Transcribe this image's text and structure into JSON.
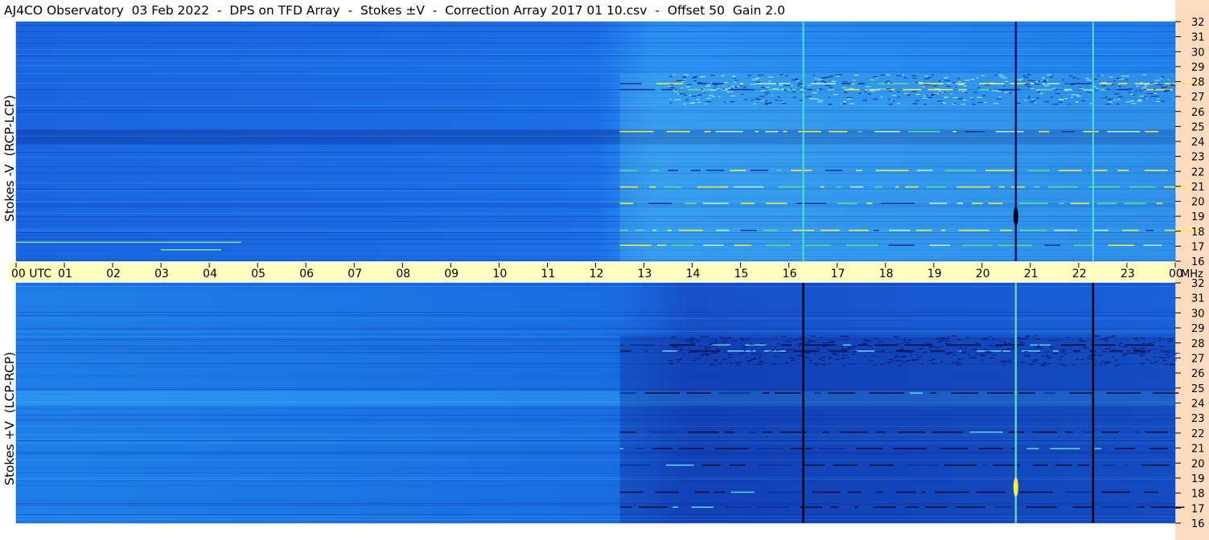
{
  "title": "AJ4CO Observatory  03 Feb 2022  -  DPS on TFD Array  -  Stokes ±V  -  Correction Array 2017 01 10.csv  -  Offset 50  Gain 2.0",
  "colors": {
    "background_blue": "#1a6fe8",
    "dark_blue": "#0a2f9a",
    "cyan": "#40c8f0",
    "green": "#5fe08a",
    "yellow": "#f0f040",
    "black": "#000000",
    "time_axis_bg": "#ffffc0",
    "freq_axis_bg": "#ffdcc0"
  },
  "chart_data": [
    {
      "type": "heatmap",
      "name": "stokes-minus-v",
      "ylabel": "Stokes -V  (RCP-LCP)",
      "y_ticks": [
        "32",
        "31",
        "30",
        "29",
        "28",
        "27",
        "26",
        "25",
        "24",
        "23",
        "22",
        "21",
        "20",
        "19",
        "18",
        "17",
        "16"
      ],
      "ylim": [
        16,
        32
      ],
      "y_unit": "MHz",
      "xlim": [
        0,
        24
      ],
      "x_unit": "UTC hours",
      "features": {
        "activity_start_hour": 12.5,
        "vertical_lines_hours": [
          16.3,
          20.7,
          22.3
        ],
        "strong_bands_mhz": [
          17.1,
          18.1,
          19.9,
          21.0,
          22.1,
          24.7,
          27.5,
          27.9
        ]
      }
    },
    {
      "type": "heatmap",
      "name": "stokes-plus-v",
      "ylabel": "Stokes +V  (LCP-RCP)",
      "y_ticks": [
        "32",
        "31",
        "30",
        "29",
        "28",
        "27",
        "26",
        "25",
        "24",
        "23",
        "22",
        "21",
        "20",
        "19",
        "18",
        "17",
        "16"
      ],
      "ylim": [
        16,
        32
      ],
      "y_unit": "MHz",
      "xlim": [
        0,
        24
      ],
      "x_unit": "UTC hours",
      "features": {
        "activity_start_hour": 12.5,
        "vertical_lines_hours": [
          16.3,
          20.7,
          22.3
        ],
        "strong_bands_mhz": [
          17.1,
          18.1,
          19.9,
          21.0,
          22.1,
          24.7,
          27.5,
          27.9
        ]
      }
    }
  ],
  "time_axis": {
    "labels": [
      "00  UTC",
      "01",
      "02",
      "03",
      "04",
      "05",
      "06",
      "07",
      "08",
      "09",
      "10",
      "11",
      "12",
      "13",
      "14",
      "15",
      "16",
      "17",
      "18",
      "19",
      "20",
      "21",
      "22",
      "23",
      "00"
    ],
    "unit": "MHz"
  }
}
